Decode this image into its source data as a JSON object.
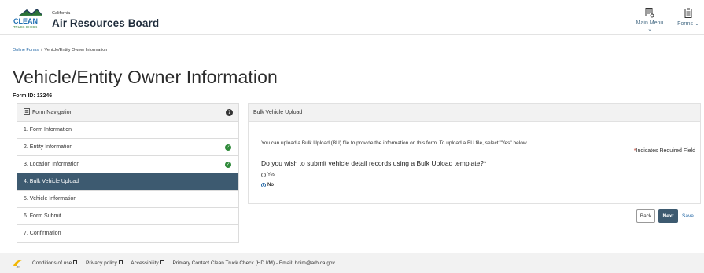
{
  "header": {
    "logo_line1": "CLEAN",
    "logo_line2": "TRUCK CHECK",
    "org_state": "California",
    "org_name": "Air Resources Board",
    "main_menu_label": "Main Menu",
    "forms_label": "Forms"
  },
  "breadcrumb": {
    "root": "Online Forms",
    "separator": "/",
    "current": "Vehicle/Entity Owner Information"
  },
  "page": {
    "title": "Vehicle/Entity Owner Information",
    "form_id": "Form ID: 13246"
  },
  "nav": {
    "title": "Form Navigation",
    "help_glyph": "?",
    "items": [
      {
        "label": "1. Form Information",
        "done": false
      },
      {
        "label": "2. Entity Information",
        "done": true
      },
      {
        "label": "3. Location Information",
        "done": true
      },
      {
        "label": "4. Bulk Vehicle Upload",
        "done": false,
        "active": true
      },
      {
        "label": "5. Vehicle Information",
        "done": false
      },
      {
        "label": "6. Form Submit",
        "done": false
      },
      {
        "label": "7. Confirmation",
        "done": false
      }
    ]
  },
  "bulk": {
    "title": "Bulk Vehicle Upload",
    "intro": "You can upload a Bulk Upload (BU) file to provide the information on this form. To upload a BU file, select \"Yes\" below.",
    "required_note": "Indicates Required Field",
    "required_star": "*",
    "question": "Do you wish to submit vehicle detail records using a Bulk Upload template?*",
    "options": [
      {
        "label": "Yes",
        "selected": false
      },
      {
        "label": "No",
        "selected": true
      }
    ]
  },
  "actions": {
    "back": "Back",
    "next": "Next",
    "save": "Save"
  },
  "footer": {
    "conditions": "Conditions of use",
    "privacy": "Privacy policy",
    "accessibility": "Accessibility",
    "contact": "Primary Contact Clean Truck Check (HD I/M) - Email: hdim@arb.ca.gov"
  },
  "colors": {
    "accent": "#3d5a70",
    "link": "#1d63a3",
    "check": "#2f8a3a",
    "logo_green": "#2e7d32",
    "logo_blue": "#1f6fb2"
  }
}
